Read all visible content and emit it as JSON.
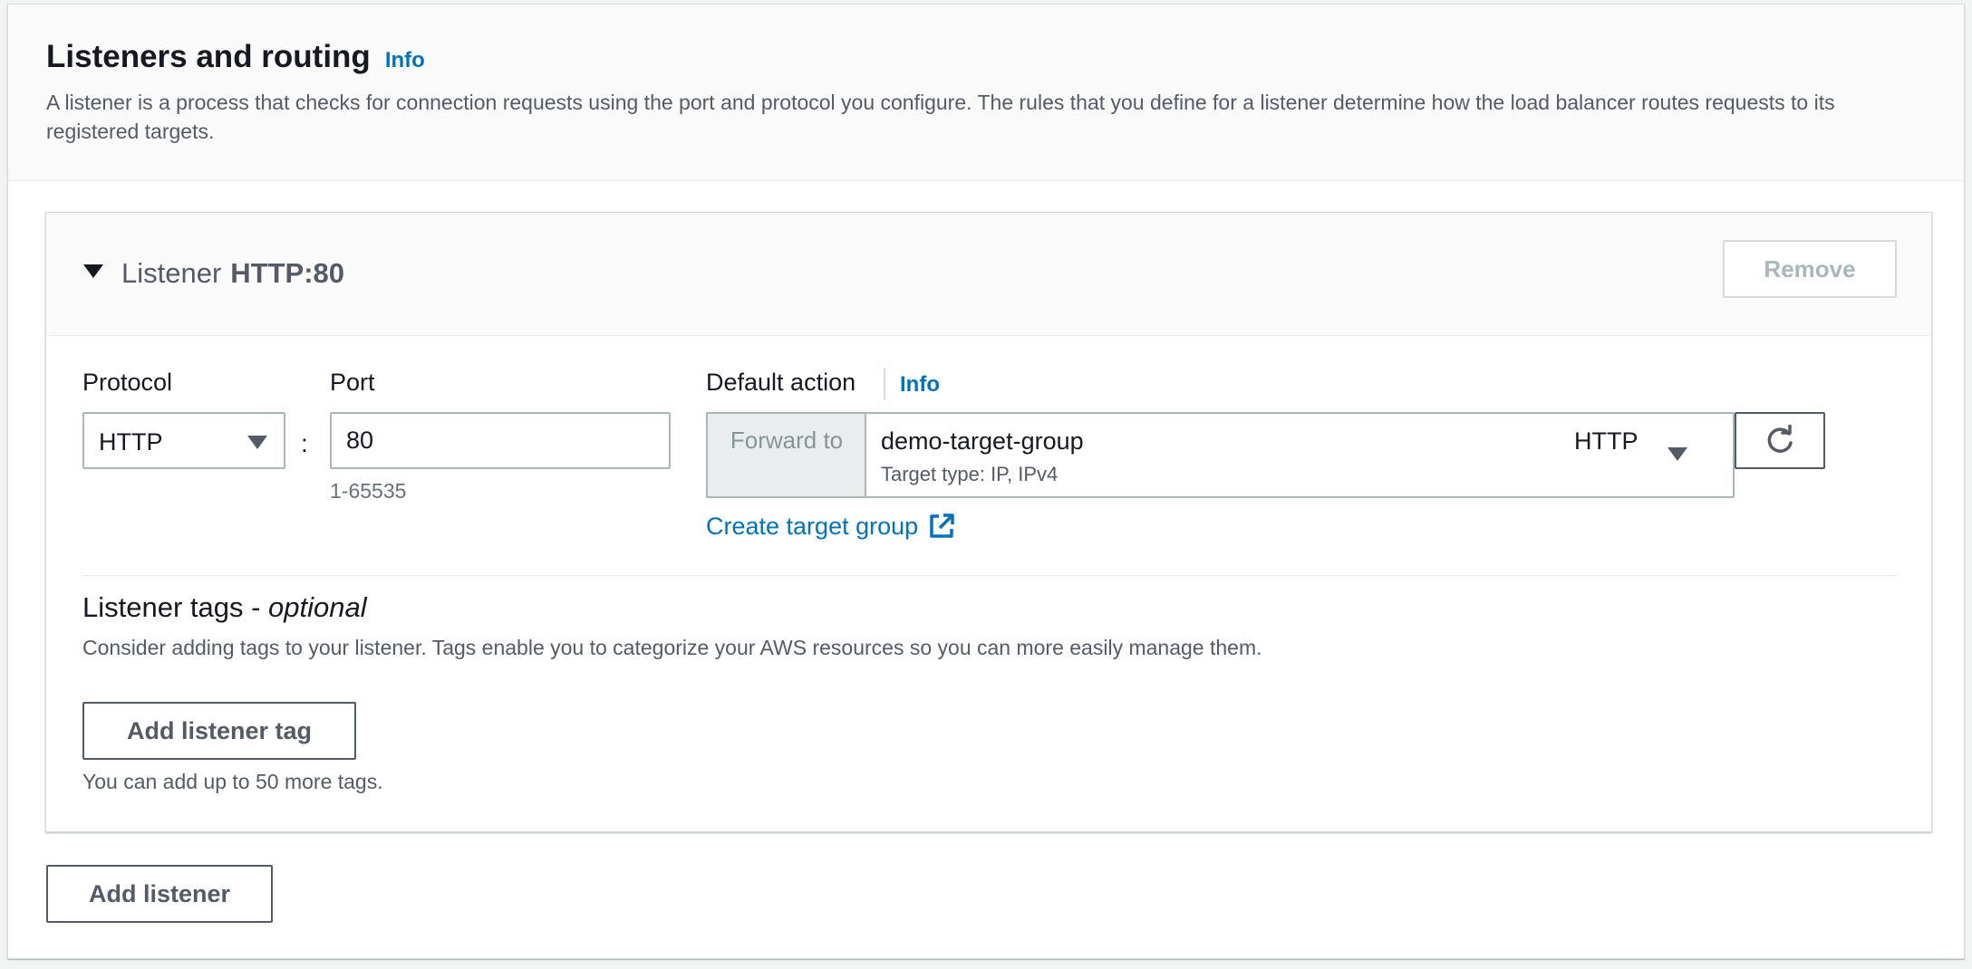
{
  "section": {
    "title": "Listeners and routing",
    "info": "Info",
    "description": "A listener is a process that checks for connection requests using the port and protocol you configure. The rules that you define for a listener determine how the load balancer routes requests to its registered targets."
  },
  "listener": {
    "label": "Listener",
    "name": "HTTP:80",
    "remove_label": "Remove",
    "protocol_label": "Protocol",
    "protocol_value": "HTTP",
    "colon": ":",
    "port_label": "Port",
    "port_value": "80",
    "port_hint": "1-65535",
    "default_action_label": "Default action",
    "default_action_info": "Info",
    "forward_to_label": "Forward to",
    "target_group_name": "demo-target-group",
    "target_group_type": "Target type: IP, IPv4",
    "target_group_protocol": "HTTP",
    "create_target_group_label": "Create target group",
    "tags_title": "Listener tags - ",
    "tags_title_optional": "optional",
    "tags_description": "Consider adding tags to your listener. Tags enable you to categorize your AWS resources so you can more easily manage them.",
    "add_tag_label": "Add listener tag",
    "tags_limit_hint": "You can add up to 50 more tags."
  },
  "add_listener_label": "Add listener",
  "icons": {
    "expand": "caret-down-icon",
    "select": "triangle-down-icon",
    "refresh": "refresh-icon",
    "external": "external-link-icon"
  },
  "colors": {
    "link": "#0073bb",
    "text": "#16191f",
    "secondary_text": "#545b64"
  }
}
